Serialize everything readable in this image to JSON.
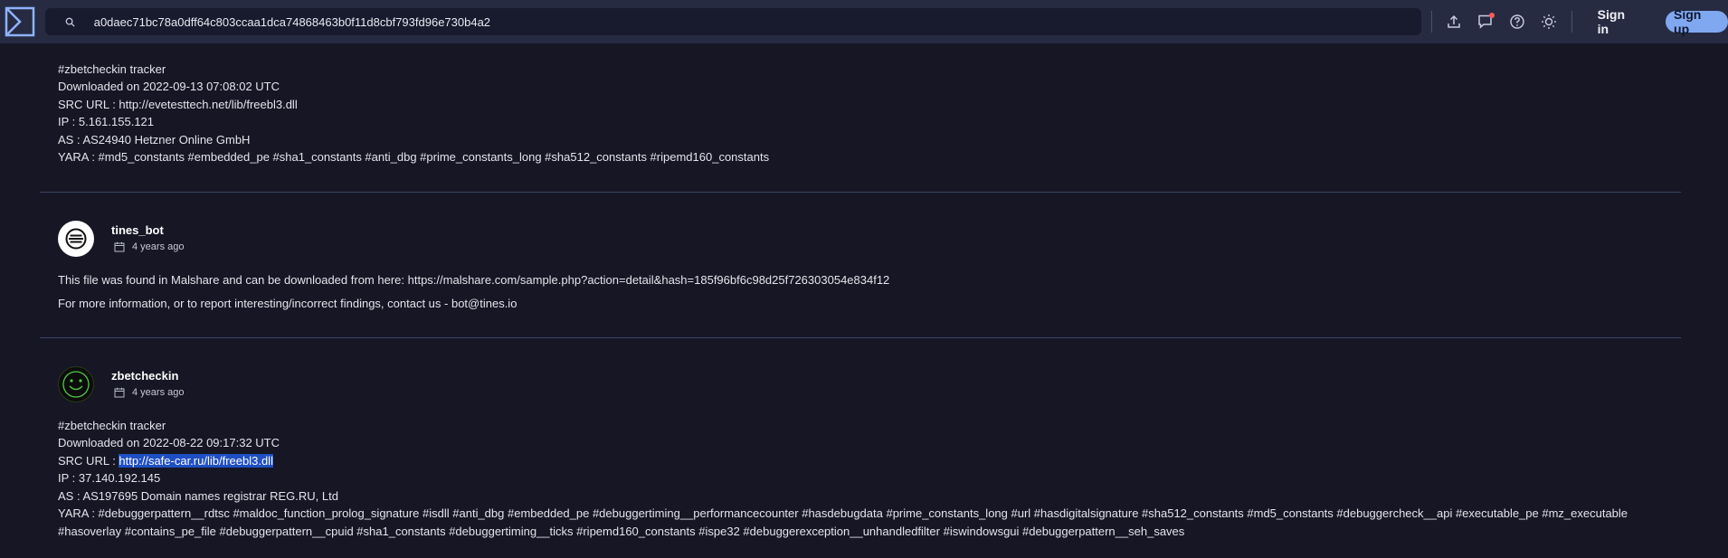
{
  "search": {
    "value": "a0daec71bc78a0dff64c803ccaa1dca74868463b0f11d8cbf793fd96e730b4a2"
  },
  "header": {
    "signin_label": "Sign in",
    "signup_label": "Sign up",
    "accent_color": "#7fa8f0",
    "icons": [
      "upload-icon",
      "comment-icon",
      "help-icon",
      "theme-sun-icon"
    ]
  },
  "comments": [
    {
      "lines": [
        "#zbetcheckin tracker",
        "Downloaded on 2022-09-13 07:08:02 UTC",
        "SRC URL : http://evetesttech.net/lib/freebl3.dll",
        "IP : 5.161.155.121",
        "AS : AS24940 Hetzner Online GmbH",
        "YARA : #md5_constants #embedded_pe #sha1_constants #anti_dbg #prime_constants_long #sha512_constants #ripemd160_constants"
      ]
    },
    {
      "user": "tines_bot",
      "time": "4 years ago",
      "lines": [
        "This file was found in Malshare and can be downloaded from here: https://malshare.com/sample.php?action=detail&hash=185f96bf6c98d25f726303054e834f12",
        "For more information, or to report interesting/incorrect findings, contact us - bot@tines.io"
      ]
    },
    {
      "user": "zbetcheckin",
      "time": "4 years ago",
      "lines": [
        "#zbetcheckin tracker",
        "Downloaded on 2022-08-22 09:17:32 UTC",
        "IP : 37.140.192.145",
        "AS : AS197695 Domain names registrar REG.RU, Ltd",
        "YARA : #debuggerpattern__rdtsc #maldoc_function_prolog_signature #isdll #anti_dbg #embedded_pe #debuggertiming__performancecounter #hasdebugdata #prime_constants_long #url #hasdigitalsignature #sha512_constants #md5_constants #debuggercheck__api #executable_pe #mz_executable",
        "#hasoverlay #contains_pe_file #debuggerpattern__cpuid #sha1_constants #debuggertiming__ticks #ripemd160_constants #ispe32 #debuggerexception__unhandledfilter #iswindowsgui #debuggerpattern__seh_saves"
      ],
      "src_prefix": "SRC URL : ",
      "src_url": "http://safe-car.ru/lib/freebl3.dll"
    }
  ]
}
